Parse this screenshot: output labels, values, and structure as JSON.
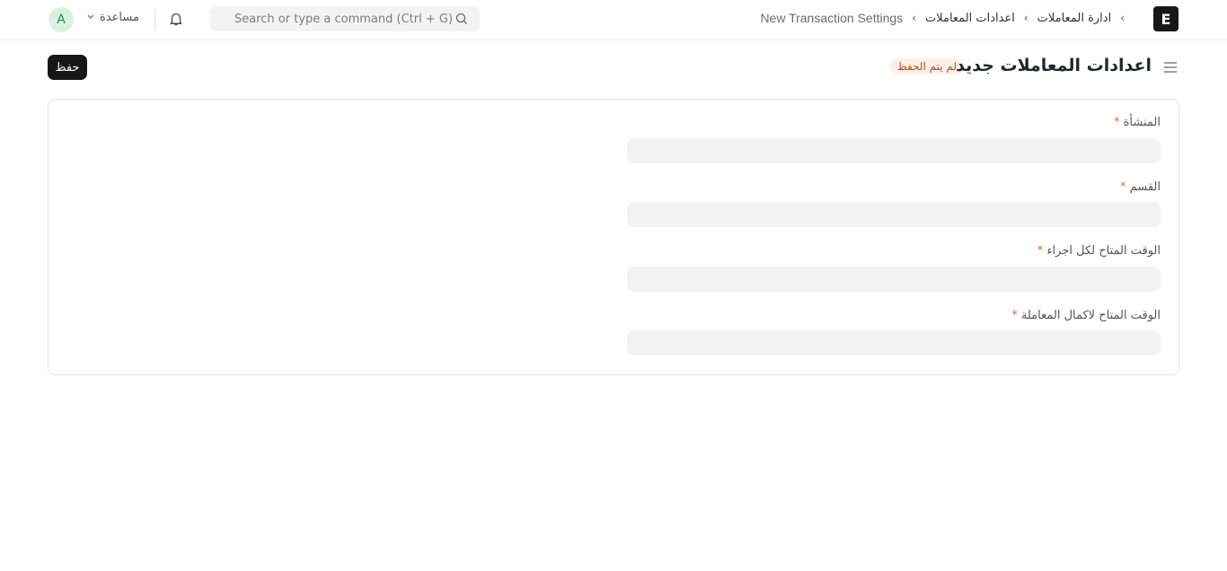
{
  "navbar": {
    "avatar_initial": "A",
    "help_label": "مساعدة",
    "search_placeholder": "Search or type a command (Ctrl + G)",
    "breadcrumbs": [
      "ادارة المعاملات",
      "اعدادات المعاملات",
      "New Transaction Settings"
    ],
    "logo_letter": "E"
  },
  "page": {
    "title": "اعدادات المعاملات جديد",
    "status_badge": "لم يتم الحفظ",
    "save_label": "حفظ"
  },
  "form": {
    "fields": [
      {
        "label": "المنشأة",
        "required_mark": "*",
        "value": ""
      },
      {
        "label": "القسم",
        "required_mark": "*",
        "value": ""
      },
      {
        "label": "الوقت المتاح لكل اجراء",
        "required_mark": "*",
        "value": ""
      },
      {
        "label": "الوقت المتاح لاكمال المعاملة",
        "required_mark": "*",
        "value": ""
      }
    ]
  }
}
